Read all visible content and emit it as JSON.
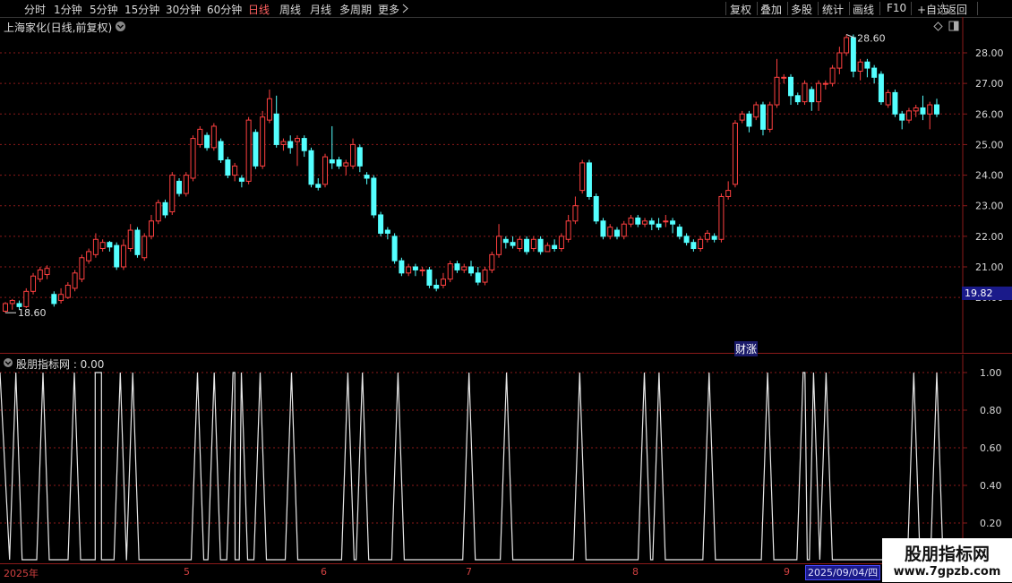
{
  "toolbar": {
    "periods": [
      "分时",
      "1分钟",
      "5分钟",
      "15分钟",
      "30分钟",
      "60分钟",
      "日线",
      "周线",
      "月线",
      "多周期",
      "更多"
    ],
    "active_period": "日线",
    "right_buttons": [
      "复权",
      "叠加",
      "多股",
      "统计",
      "画线",
      "F10",
      "+自选",
      "返回"
    ]
  },
  "stock": {
    "title": "上海家化(日线,前复权)"
  },
  "indicator": {
    "label": "股朋指标网 : 0.00"
  },
  "price_axis": {
    "ticks": [
      "28.00",
      "27.00",
      "26.00",
      "25.00",
      "24.00",
      "23.00",
      "22.00",
      "21.00",
      "20.00"
    ],
    "current_price": "19.82"
  },
  "annotations": {
    "high": "28.60",
    "low": "18.60",
    "event": "财涨"
  },
  "indicator_axis": {
    "ticks": [
      "1.00",
      "0.80",
      "0.60",
      "0.40",
      "0.20"
    ]
  },
  "x_axis": {
    "ticks": [
      "2025年",
      "5",
      "6",
      "7",
      "8",
      "9"
    ],
    "cursor_date": "2025/09/04/四"
  },
  "watermark": {
    "title": "股朋指标网",
    "url": "www.7gpzb.com"
  },
  "colors": {
    "up": "#ff4040",
    "down": "#54ffff",
    "grid": "#8b1a1a",
    "text": "#c8c8c8"
  },
  "chart_data": {
    "type": "candlestick",
    "ylim": [
      19.3,
      28.8
    ],
    "candles": [
      [
        19.55,
        19.8,
        19.5,
        19.85
      ],
      [
        19.8,
        19.9,
        19.6,
        19.95
      ],
      [
        19.8,
        19.7,
        19.6,
        19.9
      ],
      [
        19.7,
        20.2,
        19.65,
        20.3
      ],
      [
        20.2,
        20.7,
        20.1,
        20.8
      ],
      [
        20.6,
        20.9,
        20.5,
        21.0
      ],
      [
        20.75,
        20.95,
        20.6,
        21.05
      ],
      [
        20.1,
        19.8,
        19.7,
        20.2
      ],
      [
        19.9,
        20.1,
        19.8,
        20.3
      ],
      [
        20.0,
        20.4,
        19.95,
        20.5
      ],
      [
        20.3,
        20.8,
        20.2,
        20.9
      ],
      [
        20.6,
        21.3,
        20.5,
        21.4
      ],
      [
        21.2,
        21.5,
        21.1,
        21.6
      ],
      [
        21.4,
        21.9,
        21.3,
        22.1
      ],
      [
        21.6,
        21.8,
        21.5,
        21.9
      ],
      [
        21.8,
        21.65,
        21.5,
        21.85
      ],
      [
        21.7,
        21.0,
        20.9,
        21.8
      ],
      [
        21.0,
        21.7,
        20.9,
        21.9
      ],
      [
        21.6,
        22.2,
        21.5,
        22.4
      ],
      [
        22.2,
        21.4,
        21.3,
        22.3
      ],
      [
        21.3,
        22.0,
        21.2,
        22.1
      ],
      [
        22.0,
        22.5,
        21.9,
        22.7
      ],
      [
        22.5,
        23.1,
        22.4,
        23.2
      ],
      [
        23.1,
        22.7,
        22.6,
        23.2
      ],
      [
        22.8,
        24.0,
        22.7,
        24.1
      ],
      [
        23.8,
        23.4,
        23.3,
        23.9
      ],
      [
        23.4,
        24.0,
        23.3,
        24.1
      ],
      [
        23.9,
        25.2,
        23.8,
        25.3
      ],
      [
        25.0,
        25.5,
        24.9,
        25.6
      ],
      [
        25.3,
        24.9,
        24.8,
        25.4
      ],
      [
        24.9,
        25.6,
        24.8,
        25.7
      ],
      [
        25.1,
        24.5,
        24.4,
        25.2
      ],
      [
        24.5,
        24.0,
        23.9,
        24.6
      ],
      [
        24.0,
        24.3,
        23.8,
        24.4
      ],
      [
        23.9,
        23.8,
        23.6,
        24.0
      ],
      [
        23.8,
        25.8,
        23.7,
        25.9
      ],
      [
        25.4,
        24.3,
        24.2,
        25.5
      ],
      [
        24.3,
        25.9,
        24.2,
        26.1
      ],
      [
        25.8,
        26.5,
        25.7,
        26.8
      ],
      [
        26.0,
        25.0,
        24.9,
        26.6
      ],
      [
        25.0,
        25.1,
        24.8,
        25.2
      ],
      [
        25.1,
        24.9,
        24.7,
        25.3
      ],
      [
        25.1,
        25.2,
        24.3,
        25.3
      ],
      [
        25.2,
        24.8,
        24.6,
        25.3
      ],
      [
        24.8,
        23.7,
        23.6,
        24.9
      ],
      [
        23.7,
        23.6,
        23.5,
        23.9
      ],
      [
        23.7,
        24.6,
        23.6,
        24.7
      ],
      [
        24.5,
        24.4,
        24.2,
        25.6
      ],
      [
        24.5,
        24.3,
        24.2,
        24.6
      ],
      [
        24.3,
        24.4,
        24.0,
        24.5
      ],
      [
        24.3,
        25.0,
        24.2,
        25.2
      ],
      [
        24.9,
        24.3,
        24.1,
        25.0
      ],
      [
        24.0,
        23.9,
        23.7,
        24.1
      ],
      [
        23.9,
        22.7,
        22.6,
        24.0
      ],
      [
        22.7,
        22.1,
        22.0,
        22.8
      ],
      [
        22.2,
        22.1,
        21.9,
        22.3
      ],
      [
        22.0,
        21.2,
        21.1,
        22.1
      ],
      [
        21.2,
        20.8,
        20.7,
        21.3
      ],
      [
        20.8,
        21.0,
        20.7,
        21.1
      ],
      [
        21.0,
        20.9,
        20.7,
        21.1
      ],
      [
        20.9,
        20.9,
        20.7,
        21.0
      ],
      [
        20.9,
        20.4,
        20.3,
        21.0
      ],
      [
        20.4,
        20.3,
        20.2,
        20.6
      ],
      [
        20.4,
        20.6,
        20.3,
        20.8
      ],
      [
        20.6,
        21.1,
        20.5,
        21.2
      ],
      [
        21.1,
        20.9,
        20.8,
        21.2
      ],
      [
        20.9,
        21.0,
        20.8,
        21.1
      ],
      [
        21.0,
        20.8,
        20.7,
        21.2
      ],
      [
        20.8,
        20.5,
        20.4,
        21.0
      ],
      [
        20.5,
        20.9,
        20.4,
        21.0
      ],
      [
        20.9,
        21.4,
        20.8,
        21.5
      ],
      [
        21.4,
        22.0,
        21.3,
        22.4
      ],
      [
        21.9,
        21.8,
        21.6,
        22.0
      ],
      [
        21.8,
        21.7,
        21.6,
        22.0
      ],
      [
        21.6,
        21.9,
        21.5,
        22.0
      ],
      [
        21.9,
        21.5,
        21.4,
        22.0
      ],
      [
        21.6,
        21.9,
        21.5,
        22.0
      ],
      [
        21.9,
        21.5,
        21.4,
        22.0
      ],
      [
        21.5,
        21.7,
        21.5,
        21.8
      ],
      [
        21.7,
        21.6,
        21.5,
        21.9
      ],
      [
        21.6,
        22.0,
        21.5,
        22.1
      ],
      [
        21.9,
        22.5,
        21.8,
        22.7
      ],
      [
        22.5,
        23.0,
        22.4,
        23.3
      ],
      [
        23.5,
        24.4,
        23.4,
        24.5
      ],
      [
        24.4,
        23.3,
        23.2,
        24.5
      ],
      [
        23.3,
        22.5,
        22.4,
        23.4
      ],
      [
        22.5,
        22.0,
        21.9,
        22.6
      ],
      [
        22.0,
        22.3,
        21.9,
        22.4
      ],
      [
        22.2,
        22.0,
        21.9,
        22.3
      ],
      [
        22.0,
        22.4,
        21.9,
        22.5
      ],
      [
        22.4,
        22.6,
        22.3,
        22.7
      ],
      [
        22.6,
        22.4,
        22.3,
        22.7
      ],
      [
        22.4,
        22.5,
        22.3,
        22.6
      ],
      [
        22.5,
        22.4,
        22.2,
        22.6
      ],
      [
        22.4,
        22.3,
        22.2,
        22.6
      ],
      [
        22.5,
        22.5,
        22.3,
        22.7
      ],
      [
        22.5,
        22.4,
        22.1,
        22.6
      ],
      [
        22.3,
        22.0,
        21.9,
        22.4
      ],
      [
        22.0,
        21.8,
        21.7,
        22.1
      ],
      [
        21.8,
        21.6,
        21.5,
        21.9
      ],
      [
        21.6,
        21.9,
        21.5,
        22.0
      ],
      [
        21.9,
        22.1,
        21.8,
        22.2
      ],
      [
        22.0,
        21.9,
        21.8,
        22.1
      ],
      [
        21.9,
        23.3,
        21.8,
        23.4
      ],
      [
        23.3,
        23.5,
        23.2,
        23.8
      ],
      [
        23.7,
        25.7,
        23.6,
        25.8
      ],
      [
        25.8,
        26.0,
        25.7,
        26.1
      ],
      [
        26.0,
        25.6,
        25.4,
        26.1
      ],
      [
        25.9,
        26.3,
        25.8,
        26.4
      ],
      [
        26.3,
        25.5,
        25.3,
        26.4
      ],
      [
        25.5,
        26.3,
        25.4,
        26.4
      ],
      [
        26.3,
        27.2,
        26.2,
        27.8
      ],
      [
        27.2,
        27.2,
        27.0,
        27.3
      ],
      [
        27.2,
        26.6,
        26.3,
        27.3
      ],
      [
        26.6,
        26.4,
        26.3,
        26.7
      ],
      [
        26.4,
        27.0,
        26.3,
        27.1
      ],
      [
        26.8,
        26.4,
        26.1,
        26.9
      ],
      [
        26.4,
        27.0,
        26.1,
        27.1
      ],
      [
        27.0,
        27.0,
        26.8,
        27.1
      ],
      [
        27.0,
        27.5,
        26.9,
        27.6
      ],
      [
        27.5,
        28.0,
        27.3,
        28.2
      ],
      [
        28.0,
        28.5,
        27.9,
        28.6
      ],
      [
        28.5,
        27.4,
        27.2,
        28.6
      ],
      [
        27.4,
        27.7,
        27.1,
        27.8
      ],
      [
        27.7,
        27.5,
        27.2,
        27.8
      ],
      [
        27.5,
        27.2,
        27.0,
        27.6
      ],
      [
        27.3,
        26.4,
        26.3,
        27.4
      ],
      [
        26.3,
        26.7,
        26.2,
        26.8
      ],
      [
        26.7,
        26.0,
        25.9,
        26.8
      ],
      [
        26.0,
        25.8,
        25.5,
        26.1
      ],
      [
        25.8,
        26.1,
        25.7,
        26.2
      ],
      [
        26.1,
        26.2,
        25.9,
        26.3
      ],
      [
        26.2,
        26.0,
        25.8,
        26.6
      ],
      [
        26.0,
        26.3,
        25.5,
        26.4
      ],
      [
        26.3,
        26.0,
        25.9,
        26.5
      ]
    ],
    "indicator_peaks": [
      0.5,
      1.8,
      3.3,
      4.3,
      4.6,
      5.5,
      6.1,
      9.2,
      10.0,
      10.9,
      11.3,
      12.2,
      13.7,
      16.4,
      17.1,
      18.8,
      22.2,
      24.0,
      27.5,
      30.6,
      31.3,
      33.7,
      36.5,
      38.2,
      38.7,
      39.3,
      43.5,
      44.6
    ],
    "indicator_axis_range": [
      0,
      1.0
    ]
  }
}
